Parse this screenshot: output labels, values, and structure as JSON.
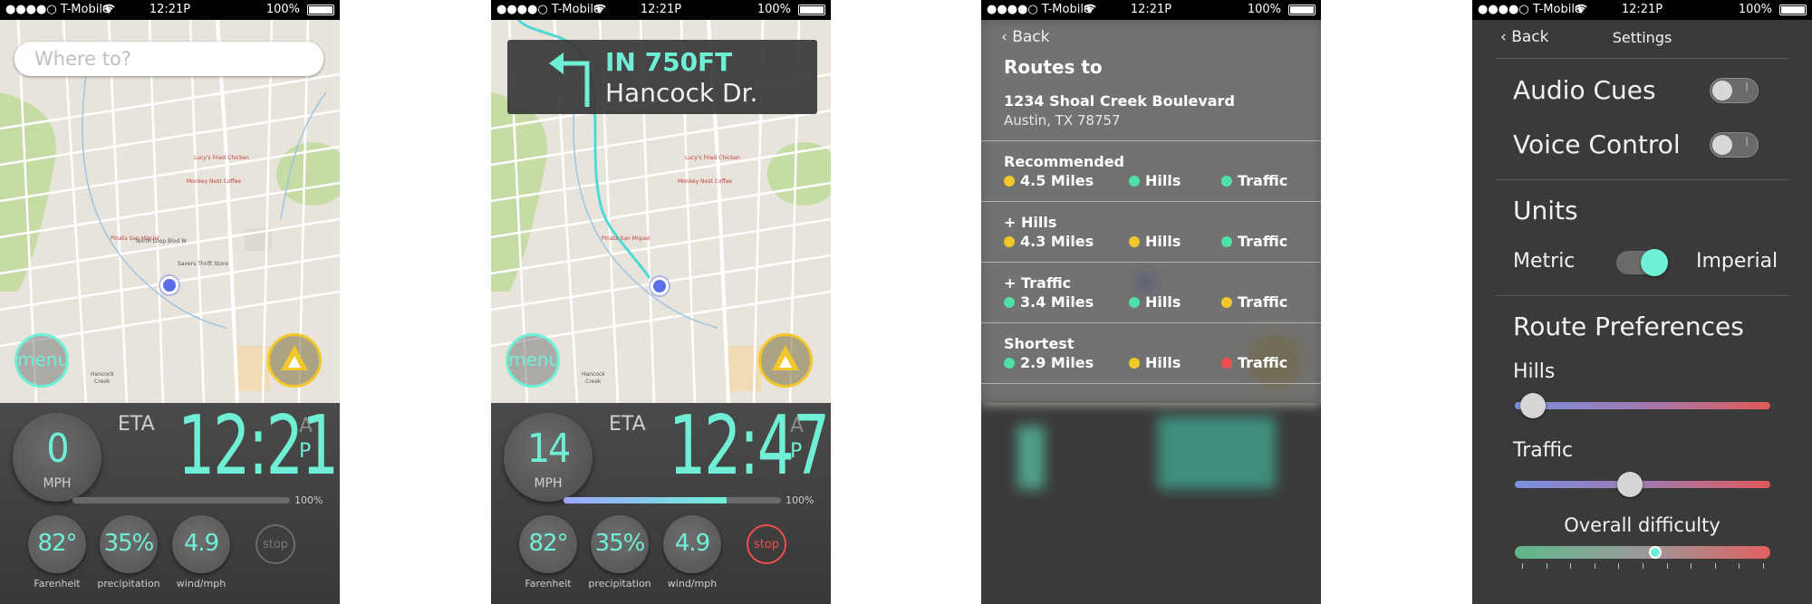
{
  "status": {
    "carrier": "●●●●○ T-Mobile",
    "time": "12:21P",
    "battery": "100%"
  },
  "screen1": {
    "search_placeholder": "Where to?",
    "menu_label": "menu",
    "speed": "0",
    "speed_unit": "MPH",
    "eta_label": "ETA",
    "eta_time": "12:21",
    "am": "A",
    "pm": "P",
    "progress_percent": 0,
    "progress_label": "100%",
    "temperature": "82°",
    "temperature_label": "Farenheit",
    "precipitation": "35%",
    "precipitation_label": "precipitation",
    "wind": "4.9",
    "wind_label": "wind/mph",
    "stop_label": "stop"
  },
  "screen2": {
    "turn_distance": "IN 750FT",
    "turn_street": "Hancock Dr.",
    "menu_label": "menu",
    "speed": "14",
    "speed_unit": "MPH",
    "eta_label": "ETA",
    "eta_time": "12:47",
    "am": "A",
    "pm": "P",
    "progress_percent": 75,
    "progress_label": "100%",
    "temperature": "82°",
    "temperature_label": "Farenheit",
    "precipitation": "35%",
    "precipitation_label": "precipitation",
    "wind": "4.9",
    "wind_label": "wind/mph",
    "stop_label": "stop"
  },
  "screen3": {
    "back": "Back",
    "title": "Routes to",
    "address_line1": "1234 Shoal Creek Boulevard",
    "address_line2": "Austin, TX 78757",
    "routes": [
      {
        "name": "Recommended",
        "miles": "4.5 Miles",
        "hills": "Hills",
        "traffic": "Traffic",
        "colors": [
          "#f1c72a",
          "#4fe0a8",
          "#4fe0a8"
        ]
      },
      {
        "name": "+ Hills",
        "miles": "4.3 Miles",
        "hills": "Hills",
        "traffic": "Traffic",
        "colors": [
          "#f1c72a",
          "#f1c72a",
          "#4fe0a8"
        ]
      },
      {
        "name": "+ Traffic",
        "miles": "3.4 Miles",
        "hills": "Hills",
        "traffic": "Traffic",
        "colors": [
          "#4fe0a8",
          "#4fe0a8",
          "#f1c72a"
        ]
      },
      {
        "name": "Shortest",
        "miles": "2.9 Miles",
        "hills": "Hills",
        "traffic": "Traffic",
        "colors": [
          "#4fe0a8",
          "#f1c72a",
          "#f04e4e"
        ]
      }
    ]
  },
  "screen4": {
    "back": "Back",
    "title": "Settings",
    "audio_cues": "Audio Cues",
    "voice_control": "Voice Control",
    "toggle_mark": "I",
    "units": "Units",
    "metric": "Metric",
    "imperial": "Imperial",
    "route_preferences": "Route Preferences",
    "hills": "Hills",
    "hills_level": 0.07,
    "traffic": "Traffic",
    "traffic_level": 0.45,
    "overall_difficulty": "Overall difficulty",
    "difficulty_level": 0.55
  },
  "map_labels": [
    "Shoal Creek",
    "Lucy's Fried Chicken",
    "Monkey Nest Coffee",
    "Pinata San Miguel",
    "Savers Thrift Store",
    "North Loop Blvd W",
    "Hancock Creek",
    "Woodrow Ave",
    "Shoalwood Ave",
    "Dry Creek"
  ],
  "colors": {
    "accent": "#6ff0d6",
    "warning": "#f1c72a",
    "stop_red": "#f04e4e"
  }
}
